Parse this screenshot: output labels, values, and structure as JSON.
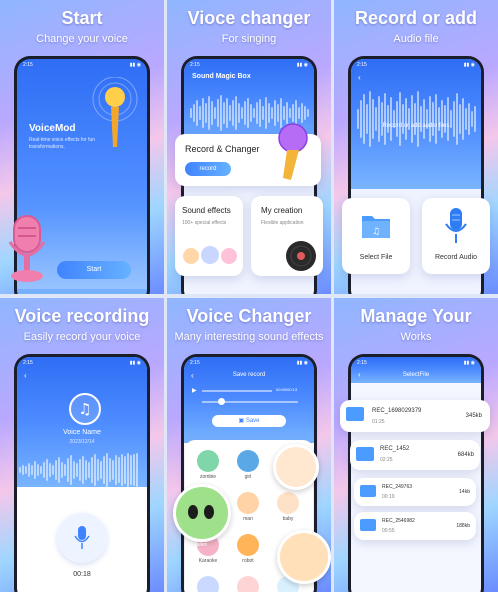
{
  "panels": [
    {
      "title": "Start",
      "subtitle": "Change your voice",
      "app_name": "VoiceMod",
      "app_desc": "Real-time voice effects for fun transformations.",
      "start_label": "Start"
    },
    {
      "title": "Vioce changer",
      "subtitle": "For singing",
      "app_header": "Sound Magic Box",
      "record_card_title": "Record & Changer",
      "record_button": "record",
      "effects_title": "Sound effects",
      "effects_desc": "100+ special effects",
      "creation_title": "My creation",
      "creation_desc": "Flexible application"
    },
    {
      "title": "Record or add",
      "subtitle": "Audio file",
      "banner_text": "Record or add audio files",
      "select_label": "Select File",
      "record_audio_label": "Record Audio"
    },
    {
      "title": "Voice recording",
      "subtitle": "Easily record your voice",
      "voice_name": "Voice  Name",
      "voice_date": "2023/12/14",
      "timer": "00:18"
    },
    {
      "title": "Voice Changer",
      "subtitle": "Many interesting sound effects",
      "header": "Save record",
      "time_label": "00:00/00:13",
      "save_label": "Save",
      "effects": [
        "zombie",
        "girl",
        "alien",
        "man",
        "baby",
        "Karaoke",
        "robot"
      ]
    },
    {
      "title": "Manage Your",
      "subtitle": "Works",
      "header": "SelectFile",
      "files": [
        {
          "name": "REC_1698029379",
          "duration": "01:25",
          "size": "345kb"
        },
        {
          "name": "REC_1452",
          "duration": "02:25",
          "size": "684kb"
        },
        {
          "name": "REC_249763",
          "duration": "00:19",
          "size": "14kb"
        },
        {
          "name": "REC_2546982",
          "duration": "00:55",
          "size": "188kb"
        }
      ]
    }
  ],
  "status_time": "2:15",
  "colors": {
    "accent": "#3f83ff",
    "deep_blue": "#2f6df5",
    "panel_gradient": "#b9a8ff"
  },
  "icons": [
    "microphone-icon",
    "back-arrow-icon",
    "folder-icon",
    "music-note-icon",
    "play-icon",
    "save-icon",
    "vinyl-icon"
  ]
}
